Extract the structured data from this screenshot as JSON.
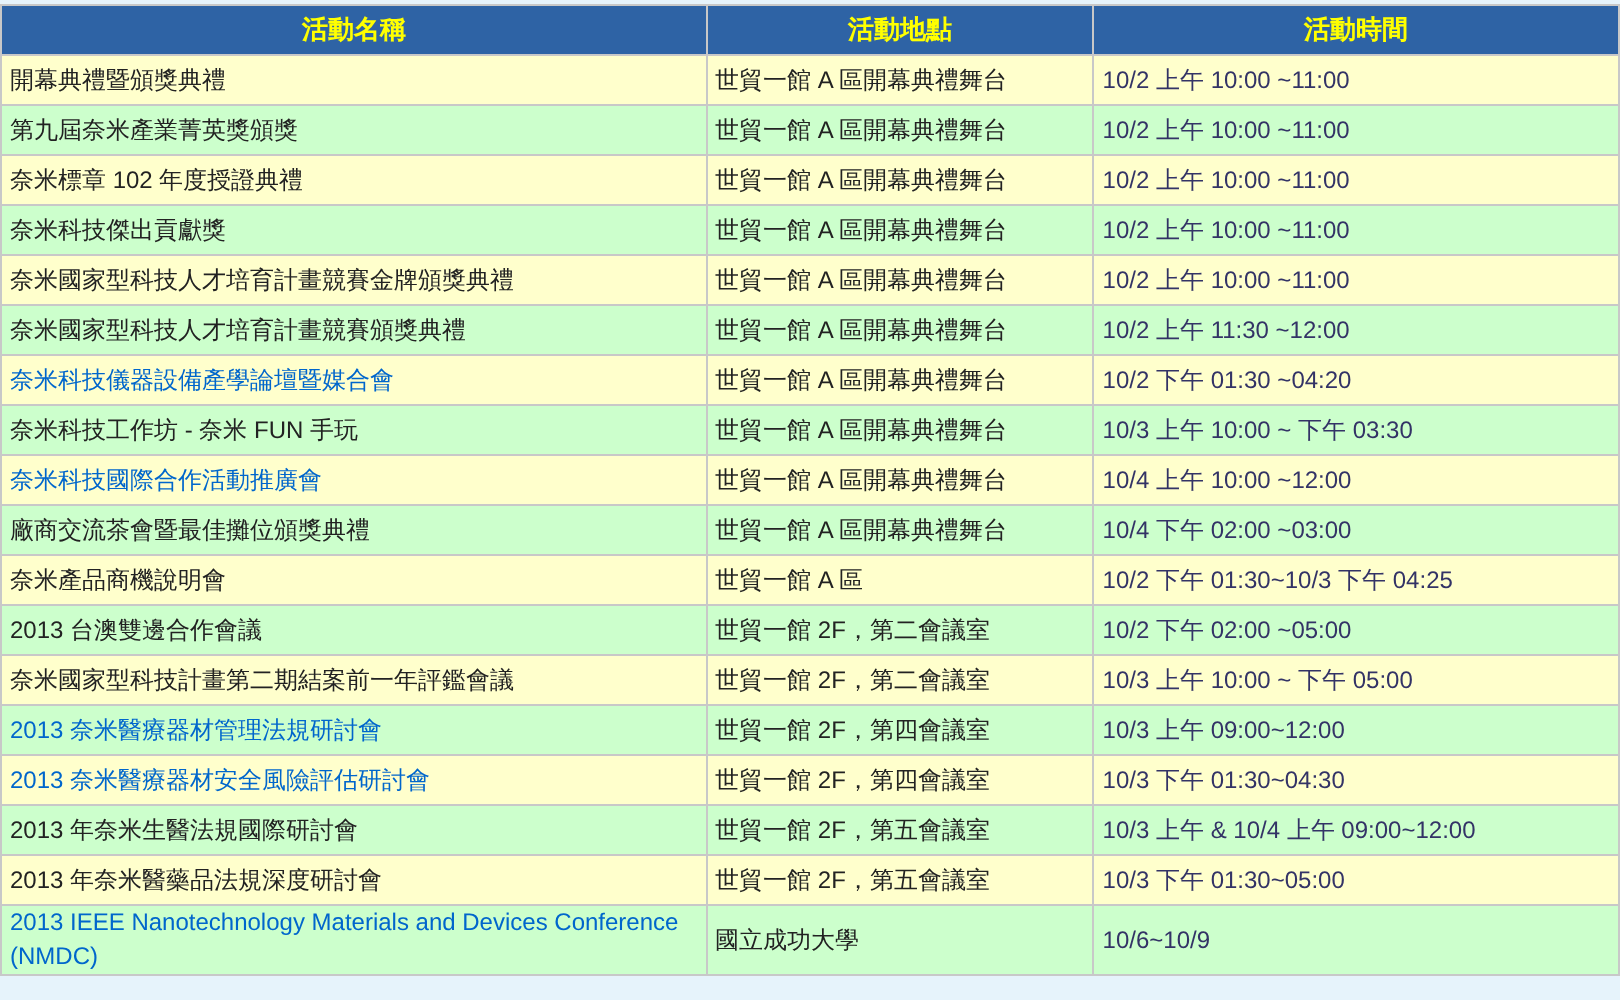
{
  "table": {
    "columns": [
      "活動名稱",
      "活動地點",
      "活動時間"
    ],
    "rows": [
      {
        "name": "開幕典禮暨頒獎典禮",
        "link": false,
        "location": "世貿一館 A 區開幕典禮舞台",
        "time": "10/2 上午 10:00 ~11:00"
      },
      {
        "name": "第九屆奈米產業菁英獎頒獎",
        "link": false,
        "location": "世貿一館 A 區開幕典禮舞台",
        "time": "10/2 上午 10:00 ~11:00"
      },
      {
        "name": "奈米標章 102 年度授證典禮",
        "link": false,
        "location": "世貿一館 A 區開幕典禮舞台",
        "time": "10/2 上午 10:00 ~11:00"
      },
      {
        "name": "奈米科技傑出貢獻獎",
        "link": false,
        "location": "世貿一館 A 區開幕典禮舞台",
        "time": "10/2 上午 10:00 ~11:00"
      },
      {
        "name": "奈米國家型科技人才培育計畫競賽金牌頒獎典禮",
        "link": false,
        "location": "世貿一館 A 區開幕典禮舞台",
        "time": "10/2 上午 10:00 ~11:00"
      },
      {
        "name": "奈米國家型科技人才培育計畫競賽頒獎典禮",
        "link": false,
        "location": "世貿一館 A 區開幕典禮舞台",
        "time": "10/2 上午 11:30 ~12:00"
      },
      {
        "name": "奈米科技儀器設備產學論壇暨媒合會",
        "link": true,
        "location": "世貿一館 A 區開幕典禮舞台",
        "time": "10/2 下午 01:30 ~04:20"
      },
      {
        "name": "奈米科技工作坊 - 奈米 FUN 手玩",
        "link": false,
        "location": "世貿一館 A 區開幕典禮舞台",
        "time": "10/3 上午 10:00 ~ 下午 03:30"
      },
      {
        "name": "奈米科技國際合作活動推廣會",
        "link": true,
        "location": "世貿一館 A 區開幕典禮舞台",
        "time": "10/4 上午 10:00 ~12:00"
      },
      {
        "name": "廠商交流茶會暨最佳攤位頒獎典禮",
        "link": false,
        "location": "世貿一館 A 區開幕典禮舞台",
        "time": "10/4 下午 02:00 ~03:00"
      },
      {
        "name": "奈米產品商機說明會",
        "link": false,
        "location": "世貿一館 A 區",
        "time": "10/2 下午 01:30~10/3 下午 04:25"
      },
      {
        "name": "2013 台澳雙邊合作會議",
        "link": false,
        "location": "世貿一館 2F，第二會議室",
        "time": "10/2 下午 02:00 ~05:00"
      },
      {
        "name": "奈米國家型科技計畫第二期結案前一年評鑑會議",
        "link": false,
        "location": "世貿一館 2F，第二會議室",
        "time": "10/3 上午 10:00 ~ 下午 05:00"
      },
      {
        "name": "2013 奈米醫療器材管理法規研討會",
        "link": true,
        "location": "世貿一館 2F，第四會議室",
        "time": "10/3 上午 09:00~12:00"
      },
      {
        "name": "2013 奈米醫療器材安全風險評估研討會",
        "link": true,
        "location": "世貿一館 2F，第四會議室",
        "time": "10/3 下午 01:30~04:30"
      },
      {
        "name": "2013 年奈米生醫法規國際研討會",
        "link": false,
        "location": "世貿一館 2F，第五會議室",
        "time": "10/3 上午 & 10/4 上午 09:00~12:00"
      },
      {
        "name": "2013 年奈米醫藥品法規深度研討會",
        "link": false,
        "location": "世貿一館 2F，第五會議室",
        "time": "10/3 下午 01:30~05:00"
      },
      {
        "name": "2013 IEEE Nanotechnology Materials and Devices Conference (NMDC)",
        "link": true,
        "location": "國立成功大學",
        "time": "10/6~10/9"
      }
    ]
  }
}
